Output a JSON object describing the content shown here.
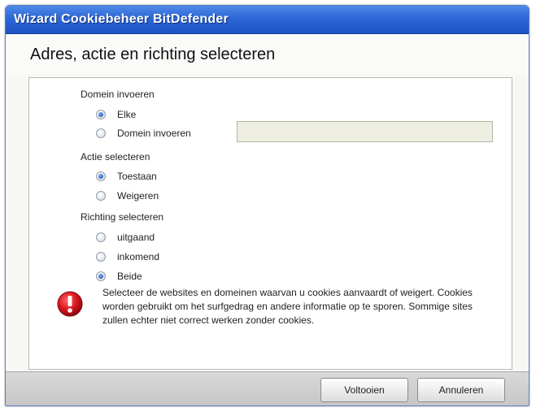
{
  "window": {
    "title": "Wizard Cookiebeheer BitDefender"
  },
  "header": {
    "title": "Adres, actie en richting selecteren"
  },
  "domain_group": {
    "label": "Domein invoeren",
    "options": [
      {
        "label": "Elke",
        "checked": true
      },
      {
        "label": "Domein invoeren",
        "checked": false
      }
    ],
    "input_value": ""
  },
  "action_group": {
    "label": "Actie selecteren",
    "options": [
      {
        "label": "Toestaan",
        "checked": true
      },
      {
        "label": "Weigeren",
        "checked": false
      }
    ]
  },
  "direction_group": {
    "label": "Richting selecteren",
    "options": [
      {
        "label": "uitgaand",
        "checked": false
      },
      {
        "label": "inkomend",
        "checked": false
      },
      {
        "label": "Beide",
        "checked": true
      }
    ]
  },
  "info": {
    "icon": "exclamation-icon",
    "text": "Selecteer de websites en domeinen waarvan u cookies aanvaardt of weigert. Cookies worden gebruikt om het surfgedrag en andere informatie op te sporen. Sommige sites zullen echter niet correct werken zonder cookies."
  },
  "footer": {
    "next_label": "Voltooien",
    "cancel_label": "Annuleren"
  },
  "colors": {
    "titlebar": "#2d67d6",
    "warning_icon": "#d8141c"
  }
}
